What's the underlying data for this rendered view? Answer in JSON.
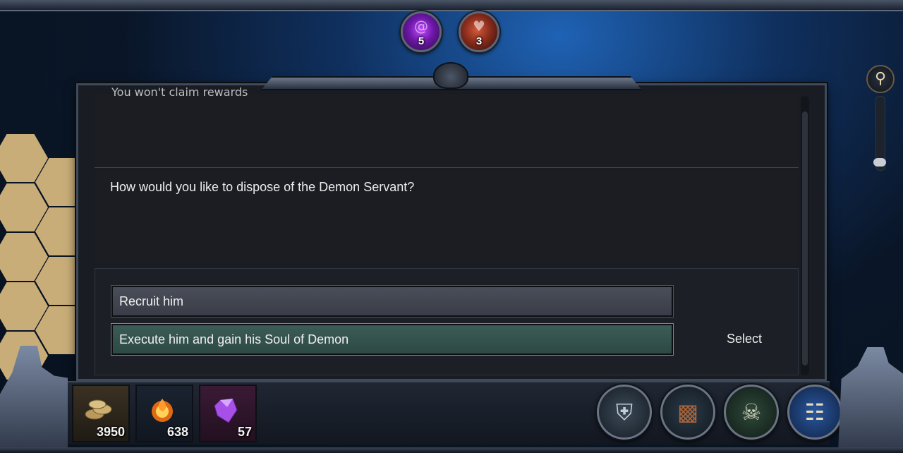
{
  "top_resources": [
    {
      "name": "soul",
      "value": "5",
      "color": "#8e2fd0",
      "icon": "purple-spiral-icon"
    },
    {
      "name": "heart",
      "value": "3",
      "color": "#a83a24",
      "icon": "heart-icon"
    }
  ],
  "dialog": {
    "previous_line_cut": "You won't claim rewards",
    "question": "How would you like to dispose of the Demon Servant?",
    "options": [
      {
        "label": "Recruit him",
        "selected": false
      },
      {
        "label": "Execute him and gain his Soul of Demon",
        "selected": true
      }
    ],
    "select_label": "Select"
  },
  "inventory": [
    {
      "name": "gold",
      "value": "3950",
      "icon": "gold-coins-icon"
    },
    {
      "name": "fire",
      "value": "638",
      "icon": "fire-orb-icon"
    },
    {
      "name": "crystal",
      "value": "57",
      "icon": "purple-crystal-icon"
    }
  ],
  "menu_buttons": [
    {
      "name": "heroes",
      "icon": "helmet-icon"
    },
    {
      "name": "inventory",
      "icon": "backpack-icon"
    },
    {
      "name": "skills",
      "icon": "skull-crossed-swords-icon"
    },
    {
      "name": "map",
      "icon": "map-scroll-icon"
    }
  ],
  "colors": {
    "panel_bg": "#1b1d23",
    "option_normal": "#44474f",
    "option_selected": "#3c5c57",
    "frame": "#3f4b5b"
  }
}
